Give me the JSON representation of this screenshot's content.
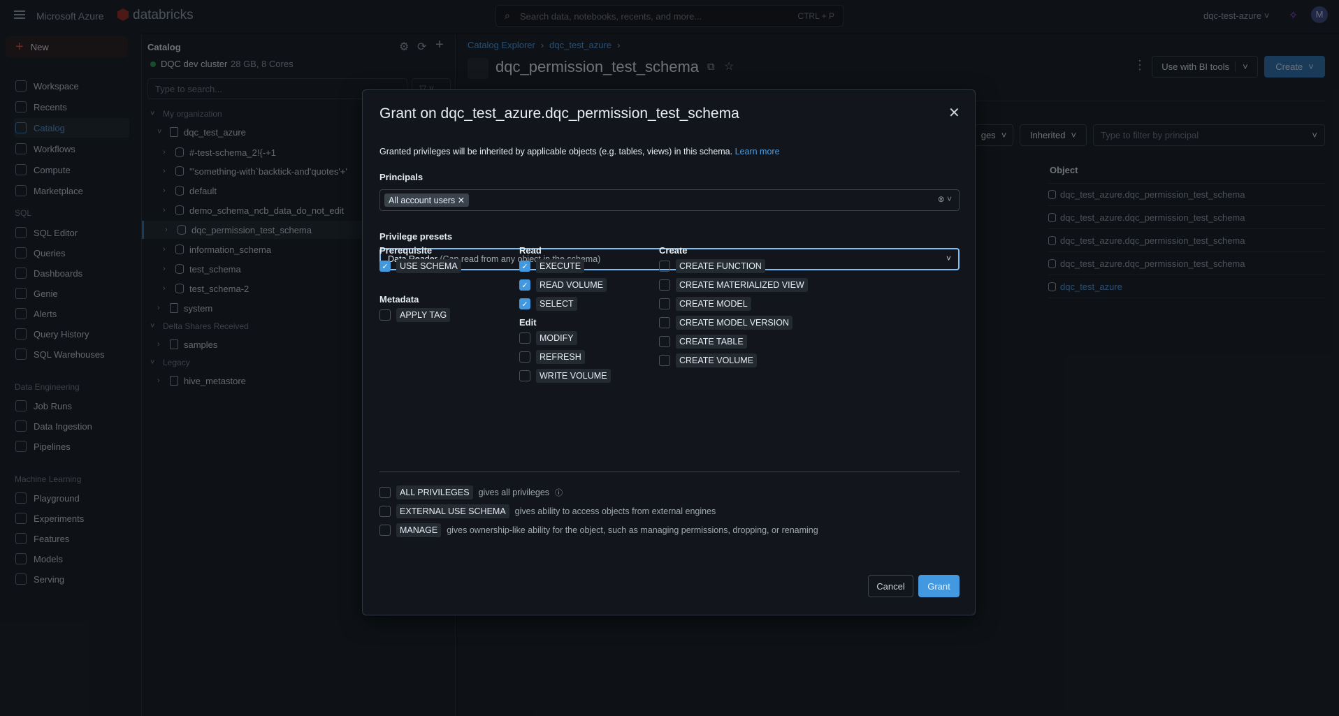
{
  "topbar": {
    "brand": "Microsoft Azure",
    "product": "databricks",
    "search_placeholder": "Search data, notebooks, recents, and more...",
    "search_shortcut": "CTRL + P",
    "workspace": "dqc-test-azure",
    "avatar": "M"
  },
  "sidebar": {
    "new_label": "New",
    "items": [
      {
        "label": "Workspace"
      },
      {
        "label": "Recents"
      },
      {
        "label": "Catalog"
      },
      {
        "label": "Workflows"
      },
      {
        "label": "Compute"
      },
      {
        "label": "Marketplace"
      }
    ],
    "sql_header": "SQL",
    "sql_items": [
      {
        "label": "SQL Editor"
      },
      {
        "label": "Queries"
      },
      {
        "label": "Dashboards"
      },
      {
        "label": "Genie"
      },
      {
        "label": "Alerts"
      },
      {
        "label": "Query History"
      },
      {
        "label": "SQL Warehouses"
      }
    ],
    "de_header": "Data Engineering",
    "de_items": [
      {
        "label": "Job Runs"
      },
      {
        "label": "Data Ingestion"
      },
      {
        "label": "Pipelines"
      }
    ],
    "ml_header": "Machine Learning",
    "ml_items": [
      {
        "label": "Playground"
      },
      {
        "label": "Experiments"
      },
      {
        "label": "Features"
      },
      {
        "label": "Models"
      },
      {
        "label": "Serving"
      }
    ],
    "active": "Catalog",
    "accent": "#4299e0"
  },
  "catalog": {
    "title": "Catalog",
    "cluster_name": "DQC dev cluster",
    "cluster_info": "28 GB, 8 Cores",
    "search_placeholder": "Type to search...",
    "tree": [
      {
        "label": "My organization",
        "type": "section"
      },
      {
        "label": "dqc_test_azure",
        "type": "catalog"
      },
      {
        "label": "#-test-schema_2!{-+1",
        "type": "schema"
      },
      {
        "label": "'\"something-with`backtick-and'quotes'+'",
        "type": "schema"
      },
      {
        "label": "default",
        "type": "schema"
      },
      {
        "label": "demo_schema_ncb_data_do_not_edit",
        "type": "schema"
      },
      {
        "label": "dqc_permission_test_schema",
        "type": "schema",
        "selected": true
      },
      {
        "label": "information_schema",
        "type": "schema"
      },
      {
        "label": "test_schema",
        "type": "schema"
      },
      {
        "label": "test_schema-2",
        "type": "schema"
      },
      {
        "label": "system",
        "type": "catalog"
      },
      {
        "label": "Delta Shares Received",
        "type": "section"
      },
      {
        "label": "samples",
        "type": "catalog"
      },
      {
        "label": "Legacy",
        "type": "section"
      },
      {
        "label": "hive_metastore",
        "type": "catalog"
      }
    ]
  },
  "main": {
    "breadcrumb": [
      "Catalog Explorer",
      "dqc_test_azure"
    ],
    "title": "dqc_permission_test_schema",
    "bi_tools": "Use with BI tools",
    "create": "Create",
    "filters": {
      "privileges_partial": "ges",
      "inherited": "Inherited",
      "principal_placeholder": "Type to filter by principal"
    },
    "table": {
      "column": "Object",
      "rows": [
        "dqc_test_azure.dqc_permission_test_schema",
        "dqc_test_azure.dqc_permission_test_schema",
        "dqc_test_azure.dqc_permission_test_schema",
        "dqc_test_azure.dqc_permission_test_schema",
        "dqc_test_azure"
      ]
    }
  },
  "dialog": {
    "title": "Grant on dqc_test_azure.dqc_permission_test_schema",
    "description": "Granted privileges will be inherited by applicable objects (e.g. tables, views) in this schema.",
    "learn_more": "Learn more",
    "principals_label": "Principals",
    "principal_chip": "All account users",
    "presets_label": "Privilege presets",
    "preset_value": "Data Reader",
    "preset_hint": "(Can read from any object in the schema)",
    "groups": {
      "prerequisite": {
        "title": "Prerequisite",
        "items": [
          {
            "label": "USE SCHEMA",
            "checked": true
          }
        ]
      },
      "metadata": {
        "title": "Metadata",
        "items": [
          {
            "label": "APPLY TAG",
            "checked": false
          }
        ]
      },
      "read": {
        "title": "Read",
        "items": [
          {
            "label": "EXECUTE",
            "checked": true
          },
          {
            "label": "READ VOLUME",
            "checked": true
          },
          {
            "label": "SELECT",
            "checked": true
          }
        ]
      },
      "edit": {
        "title": "Edit",
        "items": [
          {
            "label": "MODIFY",
            "checked": false
          },
          {
            "label": "REFRESH",
            "checked": false
          },
          {
            "label": "WRITE VOLUME",
            "checked": false
          }
        ]
      },
      "create": {
        "title": "Create",
        "items": [
          {
            "label": "CREATE FUNCTION",
            "checked": false
          },
          {
            "label": "CREATE MATERIALIZED VIEW",
            "checked": false
          },
          {
            "label": "CREATE MODEL",
            "checked": false
          },
          {
            "label": "CREATE MODEL VERSION",
            "checked": false
          },
          {
            "label": "CREATE TABLE",
            "checked": false
          },
          {
            "label": "CREATE VOLUME",
            "checked": false
          }
        ]
      }
    },
    "special": [
      {
        "label": "ALL PRIVILEGES",
        "desc": "gives all privileges",
        "checked": false
      },
      {
        "label": "EXTERNAL USE SCHEMA",
        "desc": "gives ability to access objects from external engines",
        "checked": false
      },
      {
        "label": "MANAGE",
        "desc": "gives ownership-like ability for the object, such as managing permissions, dropping, or renaming",
        "checked": false
      }
    ],
    "cancel": "Cancel",
    "grant": "Grant"
  }
}
